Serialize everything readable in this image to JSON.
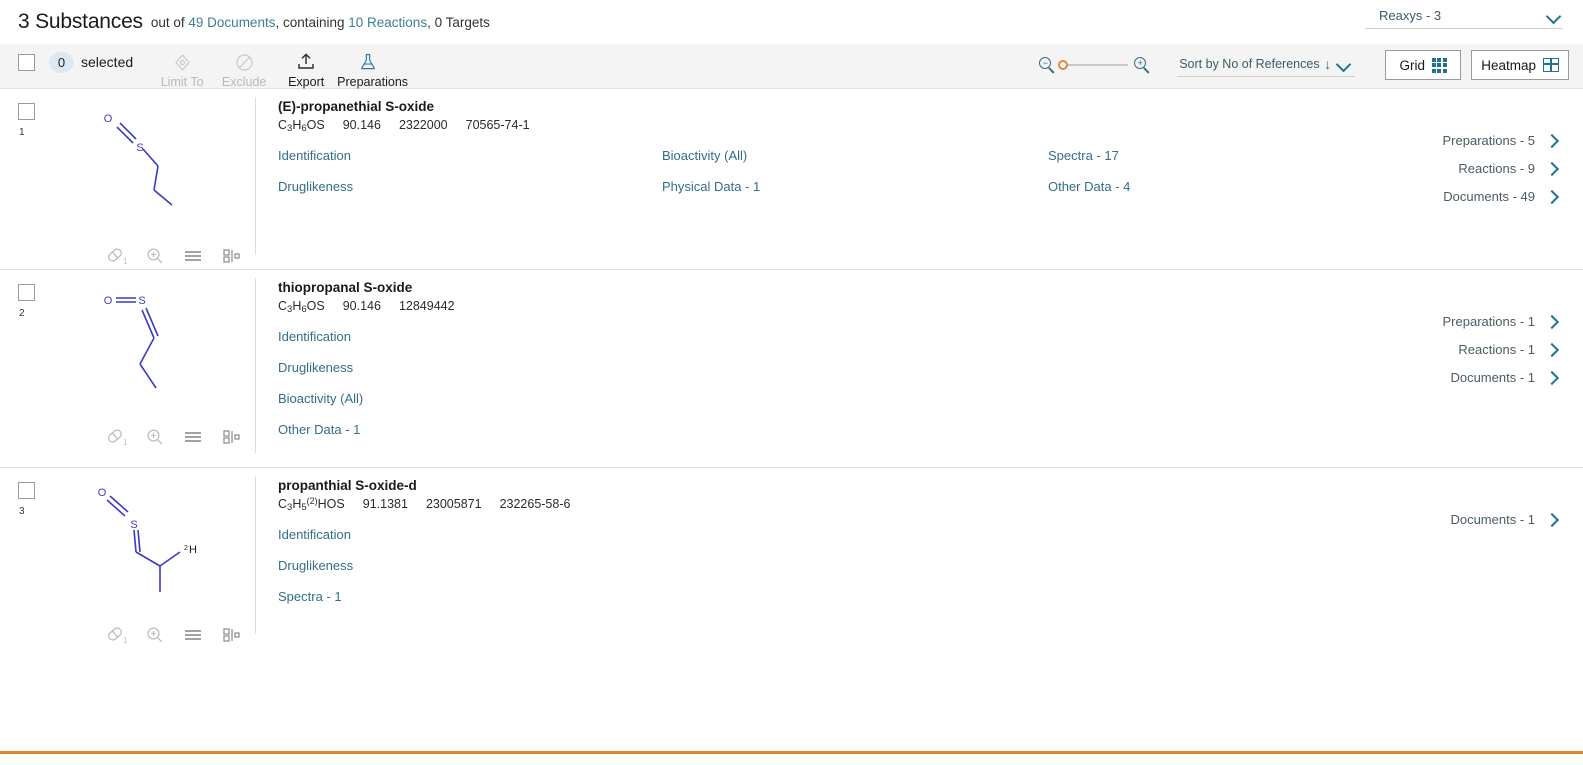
{
  "header": {
    "count_title": "3 Substances",
    "out_of_text": "out of",
    "documents_link": "49 Documents",
    "containing_text": ", containing ",
    "reactions_link": "10 Reactions",
    "targets_text": ", 0 Targets",
    "database_selector": "Reaxys - 3",
    "chevron_icon": "chevron-down-icon"
  },
  "toolbar": {
    "selected_count": "0",
    "selected_label": "selected",
    "actions": [
      {
        "label": "Limit To",
        "icon": "limit-to-icon",
        "enabled": false
      },
      {
        "label": "Exclude",
        "icon": "exclude-icon",
        "enabled": false
      },
      {
        "label": "Export",
        "icon": "export-icon",
        "enabled": true
      },
      {
        "label": "Preparations",
        "icon": "flask-icon",
        "enabled": true
      }
    ],
    "zoom_out_icon": "zoom-out-icon",
    "zoom_in_icon": "zoom-in-icon",
    "sort_label": "Sort by No of References",
    "sort_direction_icon": "arrow-down-icon",
    "grid_button": "Grid",
    "heatmap_button": "Heatmap"
  },
  "colors": {
    "accent_teal": "#1f7391",
    "link_teal": "#346e87",
    "orange_bar": "#e0822f",
    "structure_blue": "#3b3bbf",
    "pill_blue": "#dce9f2"
  },
  "rows": [
    {
      "index": "1",
      "title": "(E)-propanethial S-oxide",
      "formula_parts": [
        {
          "t": "C",
          "k": "n"
        },
        {
          "t": "3",
          "k": "sub"
        },
        {
          "t": "H",
          "k": "n"
        },
        {
          "t": "6",
          "k": "sub"
        },
        {
          "t": "OS",
          "k": "n"
        }
      ],
      "molecular_weight": "90.146",
      "reaxys_id": "2322000",
      "cas_number": "70565-74-1",
      "links_col1": [
        "Identification",
        "Druglikeness"
      ],
      "links_col2": [
        "Bioactivity (All)",
        "Physical Data - 1"
      ],
      "links_col3": [
        "Spectra - 17",
        "Other Data - 4"
      ],
      "right_links": [
        "Preparations - 5",
        "Reactions - 9",
        "Documents - 49"
      ],
      "structure_icons": [
        "pill-count-icon",
        "zoom-in-structure-icon",
        "list-view-icon",
        "structure-detail-icon"
      ],
      "pill_count": "1"
    },
    {
      "index": "2",
      "title": "thiopropanal S-oxide",
      "formula_parts": [
        {
          "t": "C",
          "k": "n"
        },
        {
          "t": "3",
          "k": "sub"
        },
        {
          "t": "H",
          "k": "n"
        },
        {
          "t": "6",
          "k": "sub"
        },
        {
          "t": "OS",
          "k": "n"
        }
      ],
      "molecular_weight": "90.146",
      "reaxys_id": "12849442",
      "cas_number": "",
      "links_col1": [
        "Identification",
        "Druglikeness",
        "Bioactivity (All)",
        "Other Data - 1"
      ],
      "links_col2": [],
      "links_col3": [],
      "right_links": [
        "Preparations - 1",
        "Reactions - 1",
        "Documents - 1"
      ],
      "structure_icons": [
        "pill-count-icon",
        "zoom-in-structure-icon",
        "list-view-icon",
        "structure-detail-icon"
      ],
      "pill_count": "1"
    },
    {
      "index": "3",
      "title": "propanthial S-oxide-d",
      "formula_parts": [
        {
          "t": "C",
          "k": "n"
        },
        {
          "t": "3",
          "k": "sub"
        },
        {
          "t": "H",
          "k": "n"
        },
        {
          "t": "5",
          "k": "sub"
        },
        {
          "t": "(2)",
          "k": "sup"
        },
        {
          "t": "HOS",
          "k": "n"
        }
      ],
      "molecular_weight": "91.1381",
      "reaxys_id": "23005871",
      "cas_number": "232265-58-6",
      "links_col1": [
        "Identification",
        "Druglikeness",
        "Spectra - 1"
      ],
      "links_col2": [],
      "links_col3": [],
      "right_links": [
        "Documents - 1"
      ],
      "structure_icons": [
        "pill-count-icon",
        "zoom-in-structure-icon",
        "list-view-icon",
        "structure-detail-icon"
      ],
      "pill_count": "1"
    }
  ]
}
